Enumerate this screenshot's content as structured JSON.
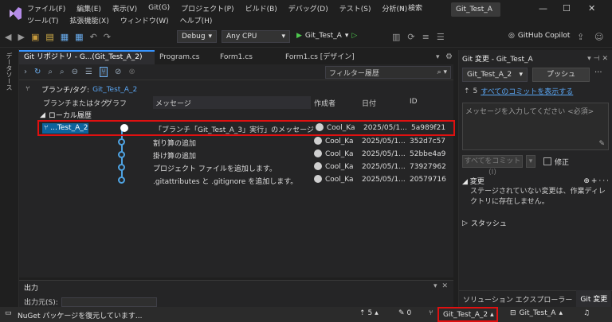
{
  "menubar": {
    "items": [
      "ファイル(F)",
      "編集(E)",
      "表示(V)",
      "Git(G)",
      "プロジェクト(P)",
      "ビルド(B)",
      "デバッグ(D)",
      "テスト(S)",
      "分析(N)"
    ],
    "items2": [
      "ツール(T)",
      "拡張機能(X)",
      "ウィンドウ(W)",
      "ヘルプ(H)"
    ],
    "search_label": "検索",
    "solution_name": "Git_Test_A"
  },
  "toolbar": {
    "config": "Debug",
    "platform": "Any CPU",
    "run_target": "Git_Test_A",
    "copilot": "GitHub Copilot"
  },
  "leftrail": {
    "label": "データソース"
  },
  "tabs": [
    "Git リポジトリ - G...(Git_Test_A_2)",
    "Program.cs",
    "Form1.cs",
    "Form1.cs [デザイン]"
  ],
  "gitrepo": {
    "filter_placeholder": "フィルター履歴",
    "branch_tag_label": "ブランチ/タグ:",
    "branch_value": "Git_Test_A_2",
    "columns": [
      "ブランチまたはタグ",
      "グラフ",
      "メッセージ",
      "作成者",
      "日付",
      "ID"
    ],
    "section": "ローカル履歴",
    "commits": [
      {
        "branch": "...Test_A_2",
        "message": "「ブランチ「Git_Test_A_3」実行」のメッセージポッ...",
        "author": "Cool_Ka",
        "date": "2025/05/1...",
        "id": "5a989f21"
      },
      {
        "branch": "",
        "message": "割り算の追加",
        "author": "Cool_Ka",
        "date": "2025/05/1...",
        "id": "352d7c57"
      },
      {
        "branch": "",
        "message": "掛け算の追加",
        "author": "Cool_Ka",
        "date": "2025/05/1...",
        "id": "52bbe4a9"
      },
      {
        "branch": "",
        "message": "プロジェクト ファイルを追加します。",
        "author": "Cool_Ka",
        "date": "2025/05/1...",
        "id": "73927962"
      },
      {
        "branch": "",
        "message": ".gitattributes と .gitignore を追加します。",
        "author": "Cool_Ka",
        "date": "2025/05/1...",
        "id": "20579716"
      }
    ]
  },
  "output": {
    "title": "出力",
    "source_label": "出力元(S):"
  },
  "gitchanges": {
    "title": "Git 変更 - Git_Test_A",
    "branch": "Git_Test_A_2",
    "push": "プッシュ",
    "outgoing_count": "5",
    "show_all": "すべてのコミットを表示する",
    "message_placeholder": "メッセージを入力してください <必須>",
    "commit_all": "すべてをコミット(I)",
    "amend": "修正",
    "changes_title": "変更",
    "changes_text": "ステージされていない変更は、作業ディレクトリに存在しません。",
    "stash_title": "スタッシュ",
    "tab_solution": "ソリューション エクスプローラー",
    "tab_git": "Git 変更"
  },
  "status": {
    "message": "NuGet パッケージを復元しています...",
    "up_count": "5",
    "pencil_count": "0",
    "branch": "Git_Test_A_2",
    "repo": "Git_Test_A"
  },
  "colors": {
    "accent": "#3794ff",
    "graph": "#4ea3e2",
    "highlight": "#e01010",
    "selected_branch": "#0e639c"
  }
}
